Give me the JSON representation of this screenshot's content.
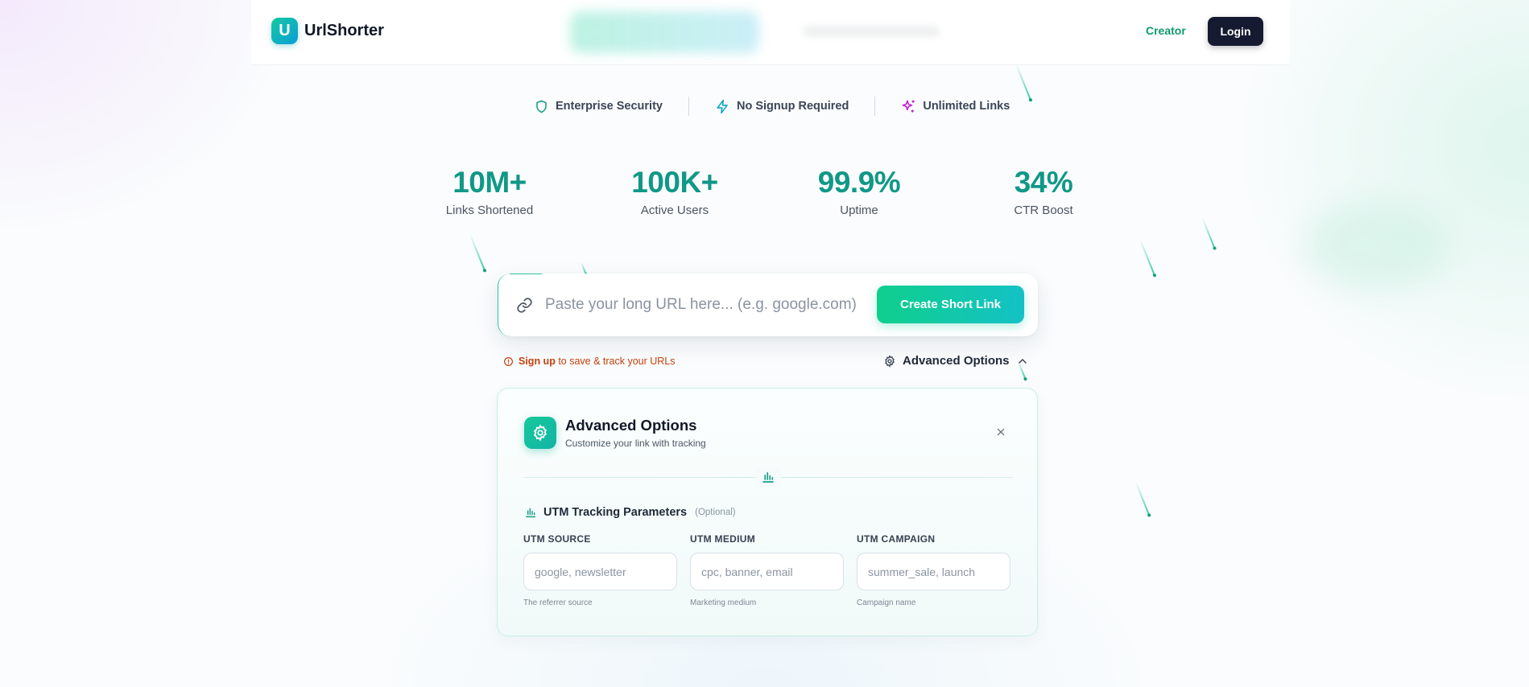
{
  "colors": {
    "accent": "#109887",
    "accent_gradient_start": "#0fcf8c",
    "accent_gradient_end": "#14c2c6",
    "dark_button": "#151a30",
    "warning": "#c2410c"
  },
  "header": {
    "brand_initial": "U",
    "brand_name": "UrlShorter",
    "creator_label": "Creator",
    "login_label": "Login"
  },
  "features": [
    {
      "icon": "shield-icon",
      "label": "Enterprise Security"
    },
    {
      "icon": "lightning-icon",
      "label": "No Signup Required"
    },
    {
      "icon": "sparkles-icon",
      "label": "Unlimited Links"
    }
  ],
  "stats": [
    {
      "value": "10M+",
      "label": "Links Shortened"
    },
    {
      "value": "100K+",
      "label": "Active Users"
    },
    {
      "value": "99.9%",
      "label": "Uptime"
    },
    {
      "value": "34%",
      "label": "CTR Boost"
    }
  ],
  "shortener": {
    "url_placeholder": "Paste your long URL here... (e.g. google.com)",
    "url_value": "",
    "create_label": "Create Short Link",
    "signup_link": "Sign up",
    "signup_note": "to save & track your URLs",
    "advanced_toggle_label": "Advanced Options"
  },
  "advanced": {
    "title": "Advanced Options",
    "subtitle": "Customize your link with tracking",
    "utm_title": "UTM Tracking Parameters",
    "utm_optional": "(Optional)",
    "fields": [
      {
        "label": "UTM SOURCE",
        "placeholder": "google, newsletter",
        "value": "",
        "help": "The referrer source"
      },
      {
        "label": "UTM MEDIUM",
        "placeholder": "cpc, banner, email",
        "value": "",
        "help": "Marketing medium"
      },
      {
        "label": "UTM CAMPAIGN",
        "placeholder": "summer_sale, launch",
        "value": "",
        "help": "Campaign name"
      }
    ]
  }
}
